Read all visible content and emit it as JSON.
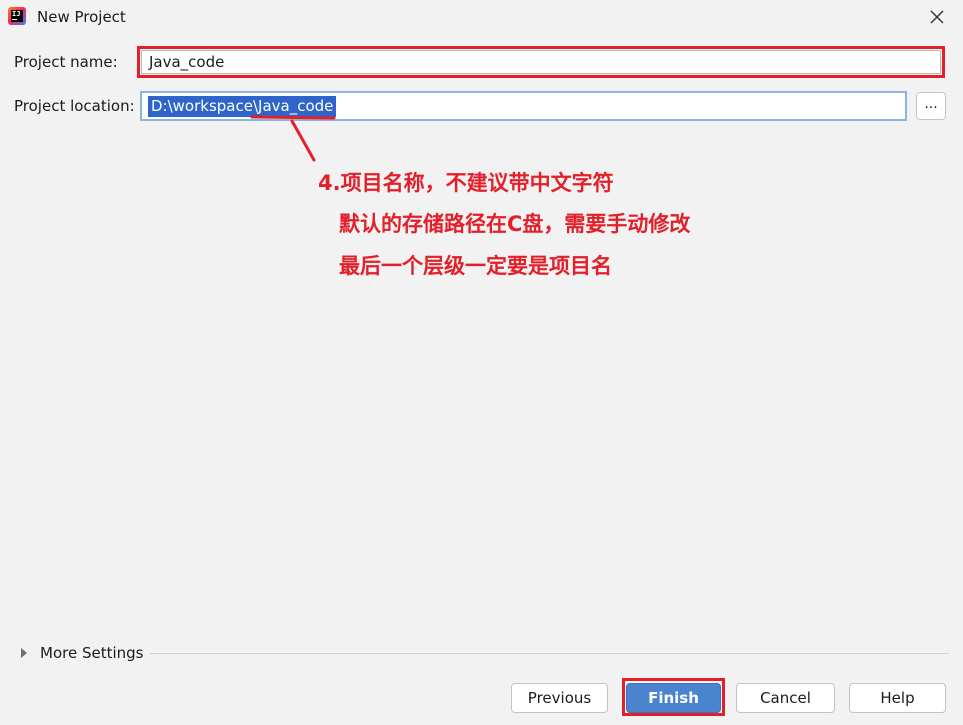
{
  "window": {
    "title": "New Project",
    "app_icon_text": "IJ"
  },
  "form": {
    "project_name_label": "Project name:",
    "project_name_value": "Java_code",
    "project_location_label": "Project location:",
    "project_location_value": "D:\\workspace\\Java_code",
    "browse_label": "..."
  },
  "annotation": {
    "color": "#e3202a",
    "lines": [
      "4.项目名称，不建议带中文字符",
      "默认的存储路径在C盘，需要手动修改",
      "最后一个层级一定要是项目名"
    ]
  },
  "more_settings": {
    "label": "More Settings"
  },
  "buttons": {
    "previous": "Previous",
    "finish": "Finish",
    "cancel": "Cancel",
    "help": "Help"
  },
  "colors": {
    "finish_button": "#4a84ce",
    "selection": "#2f65ca",
    "focus_border": "#8cb4df"
  }
}
